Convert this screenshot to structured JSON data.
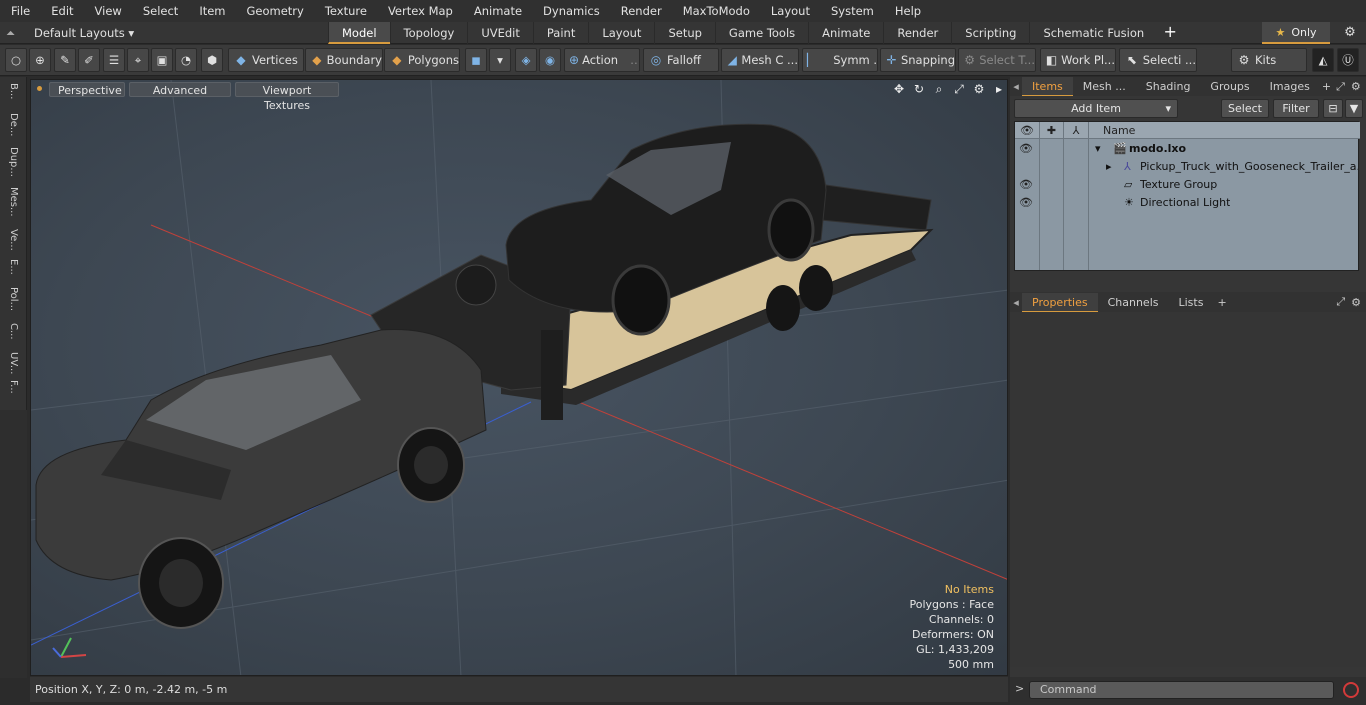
{
  "menu": [
    "File",
    "Edit",
    "View",
    "Select",
    "Item",
    "Geometry",
    "Texture",
    "Vertex Map",
    "Animate",
    "Dynamics",
    "Render",
    "MaxToModo",
    "Layout",
    "System",
    "Help"
  ],
  "layout": {
    "default_label": "Default Layouts ▾",
    "tabs": [
      "Model",
      "Topology",
      "UVEdit",
      "Paint",
      "Layout",
      "Setup",
      "Game Tools",
      "Animate",
      "Render",
      "Scripting",
      "Schematic Fusion"
    ],
    "active_tab": "Model",
    "only_label": "Only"
  },
  "toolbar": {
    "vertices": "Vertices",
    "boundary": "Boundary",
    "polygons": "Polygons",
    "action": "Action",
    "falloff": "Falloff",
    "mesh": "Mesh C ...",
    "symm": "Symm ...",
    "snapping": "Snapping",
    "select_t": "Select T...",
    "work_pl": "Work Pl...",
    "selecti": "Selecti ...",
    "kits": "Kits"
  },
  "left_tabs": [
    "B...",
    "De...",
    "Dup...",
    "Mes...",
    "Ve...",
    "E...",
    "Pol...",
    "C...",
    "UV...",
    "F..."
  ],
  "viewport": {
    "tabs": [
      "Perspective",
      "Advanced",
      "Viewport Textures"
    ],
    "stats": {
      "no_items": "No Items",
      "polygons": "Polygons : Face",
      "channels": "Channels: 0",
      "deformers": "Deformers: ON",
      "gl": "GL: 1,433,209",
      "scale": "500 mm"
    }
  },
  "status": {
    "position": "Position X, Y, Z:   0 m, -2.42 m, -5 m"
  },
  "items_panel": {
    "tabs": [
      "Items",
      "Mesh ...",
      "Shading",
      "Groups",
      "Images"
    ],
    "active_tab": "Items",
    "add_item": "Add Item",
    "select": "Select",
    "filter": "Filter",
    "name_header": "Name",
    "rows": [
      {
        "label": "modo.lxo",
        "bold": true
      },
      {
        "label": "Pickup_Truck_with_Gooseneck_Trailer_a..."
      },
      {
        "label": "Texture Group"
      },
      {
        "label": "Directional Light"
      }
    ]
  },
  "properties_panel": {
    "tabs": [
      "Properties",
      "Channels",
      "Lists"
    ],
    "active_tab": "Properties"
  },
  "command": {
    "placeholder": "Command"
  },
  "colors": {
    "accent": "#d79b3e",
    "viewport_bg": "#3d4752"
  }
}
